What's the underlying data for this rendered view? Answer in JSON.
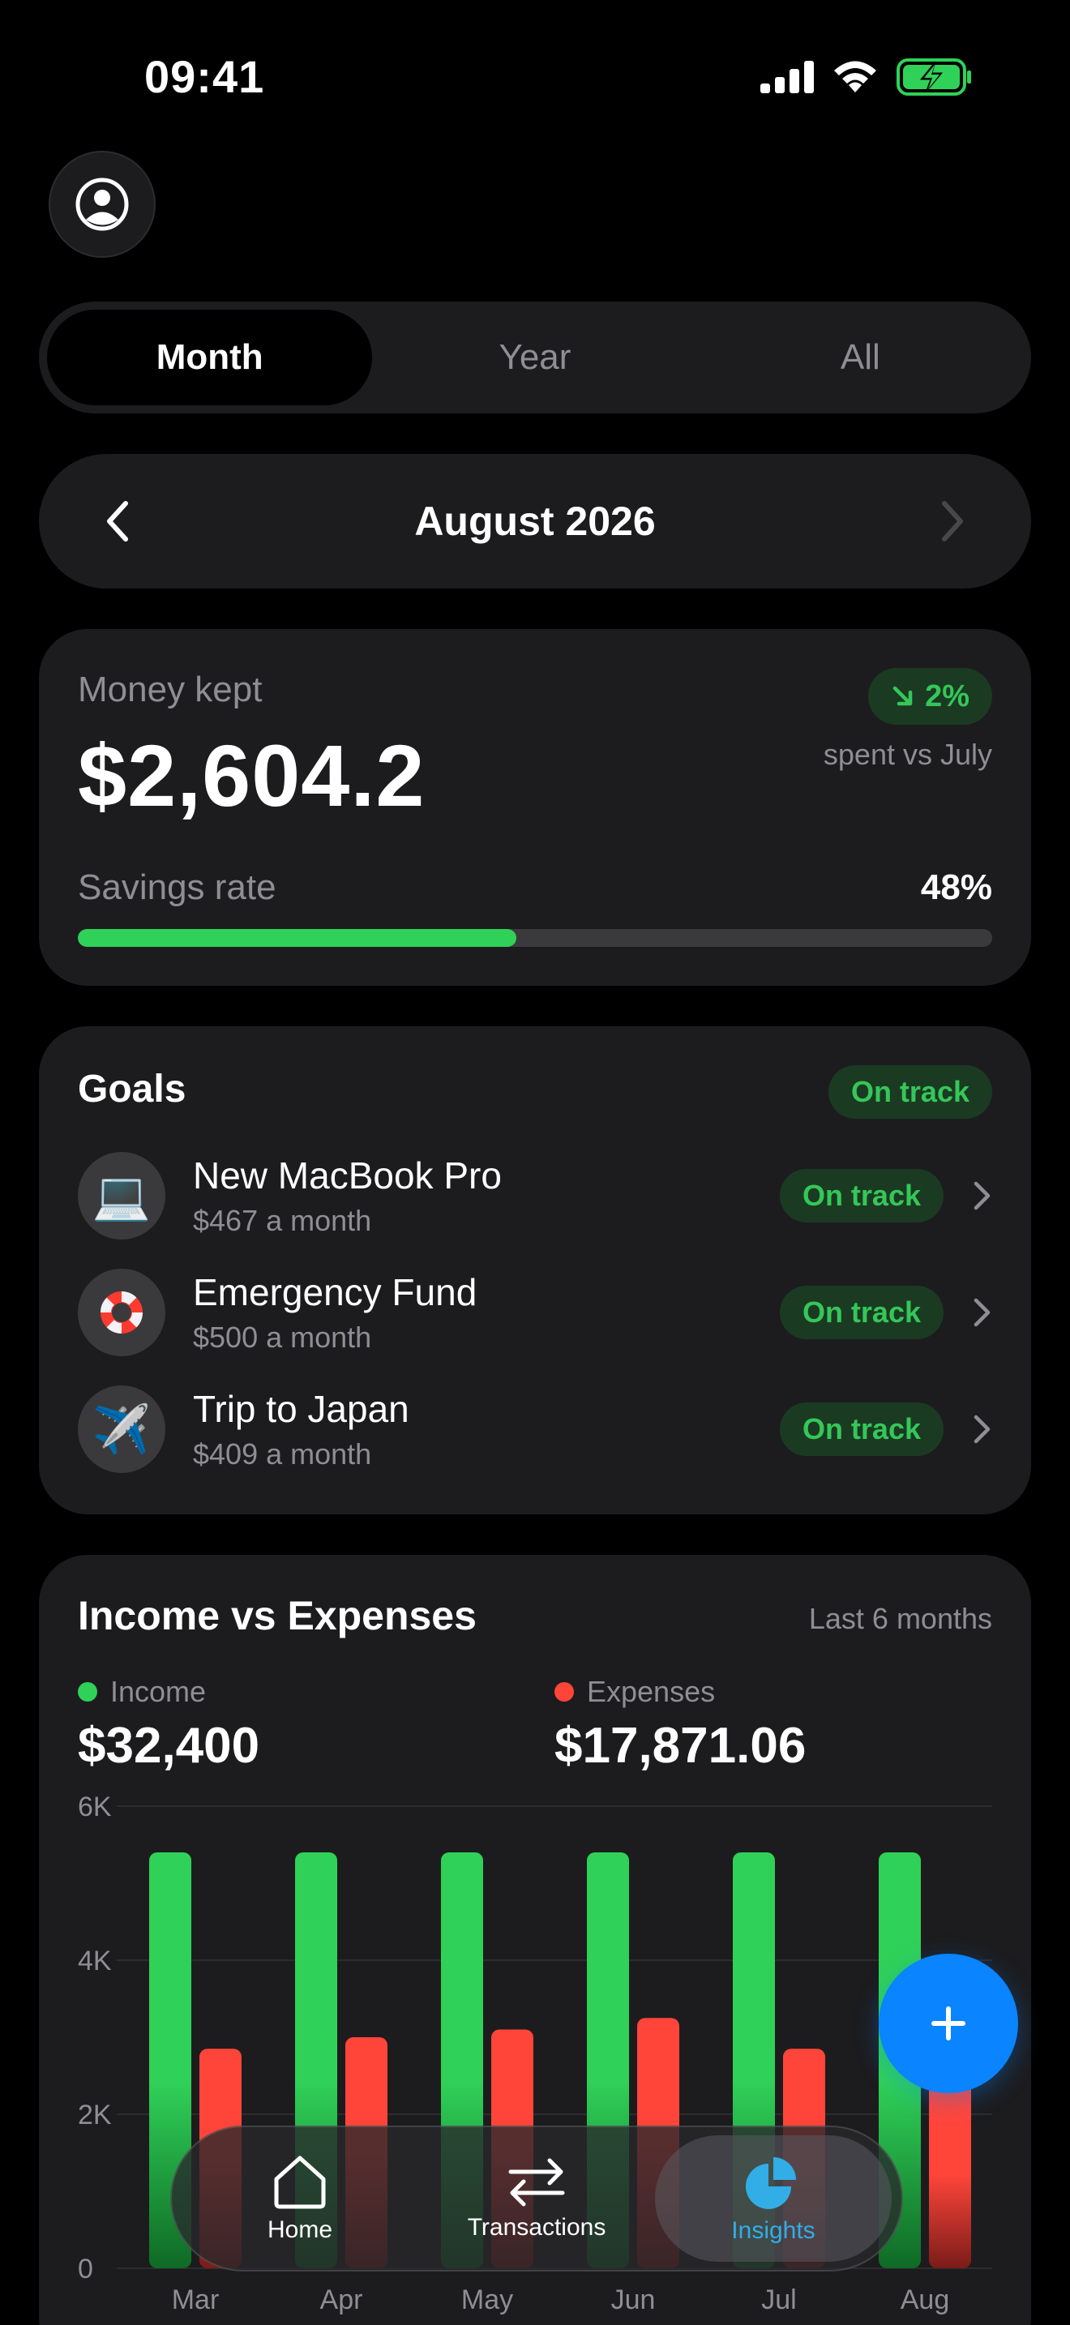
{
  "status_bar": {
    "time": "09:41"
  },
  "segments": [
    {
      "label": "Month",
      "active": true
    },
    {
      "label": "Year",
      "active": false
    },
    {
      "label": "All",
      "active": false
    }
  ],
  "month_picker": {
    "label": "August 2026"
  },
  "summary": {
    "label": "Money kept",
    "amount": "$2,604.2",
    "change_badge": "2%",
    "change_caption": "spent vs July",
    "savings_label": "Savings rate",
    "savings_value": "48%",
    "savings_fraction": 0.48
  },
  "goals": {
    "title": "Goals",
    "overall_status": "On track",
    "items": [
      {
        "name": "New MacBook Pro",
        "monthly": "$467 a month",
        "status": "On track",
        "icon": "laptop-icon",
        "emoji": "💻"
      },
      {
        "name": "Emergency Fund",
        "monthly": "$500 a month",
        "status": "On track",
        "icon": "lifebuoy-icon",
        "emoji": "🛟"
      },
      {
        "name": "Trip to Japan",
        "monthly": "$409 a month",
        "status": "On track",
        "icon": "airplane-icon",
        "emoji": "✈️"
      }
    ]
  },
  "income_vs_expenses": {
    "title": "Income vs Expenses",
    "period": "Last 6 months",
    "income_label": "Income",
    "income_total": "$32,400",
    "expenses_label": "Expenses",
    "expenses_total": "$17,871.06"
  },
  "chart_data": {
    "type": "bar",
    "categories": [
      "Mar",
      "Apr",
      "May",
      "Jun",
      "Jul",
      "Aug"
    ],
    "series": [
      {
        "name": "Income",
        "values": [
          5400,
          5400,
          5400,
          5400,
          5400,
          5400
        ]
      },
      {
        "name": "Expenses",
        "values": [
          2850,
          3000,
          3100,
          3250,
          2850,
          2450
        ]
      }
    ],
    "y_ticks": [
      "0",
      "2K",
      "4K",
      "6K"
    ],
    "y_tick_values": [
      0,
      2000,
      4000,
      6000
    ],
    "ylim": [
      0,
      6000
    ],
    "grid": true
  },
  "colors": {
    "income": "#30d158",
    "expenses": "#ff453a",
    "accent": "#0a84ff",
    "active_tab": "#32ade6"
  },
  "fab": {
    "icon": "plus-icon"
  },
  "tab_bar": {
    "items": [
      {
        "label": "Home",
        "icon": "home-icon",
        "active": false
      },
      {
        "label": "Transactions",
        "icon": "transfer-arrows-icon",
        "active": false
      },
      {
        "label": "Insights",
        "icon": "pie-chart-icon",
        "active": true
      }
    ]
  }
}
